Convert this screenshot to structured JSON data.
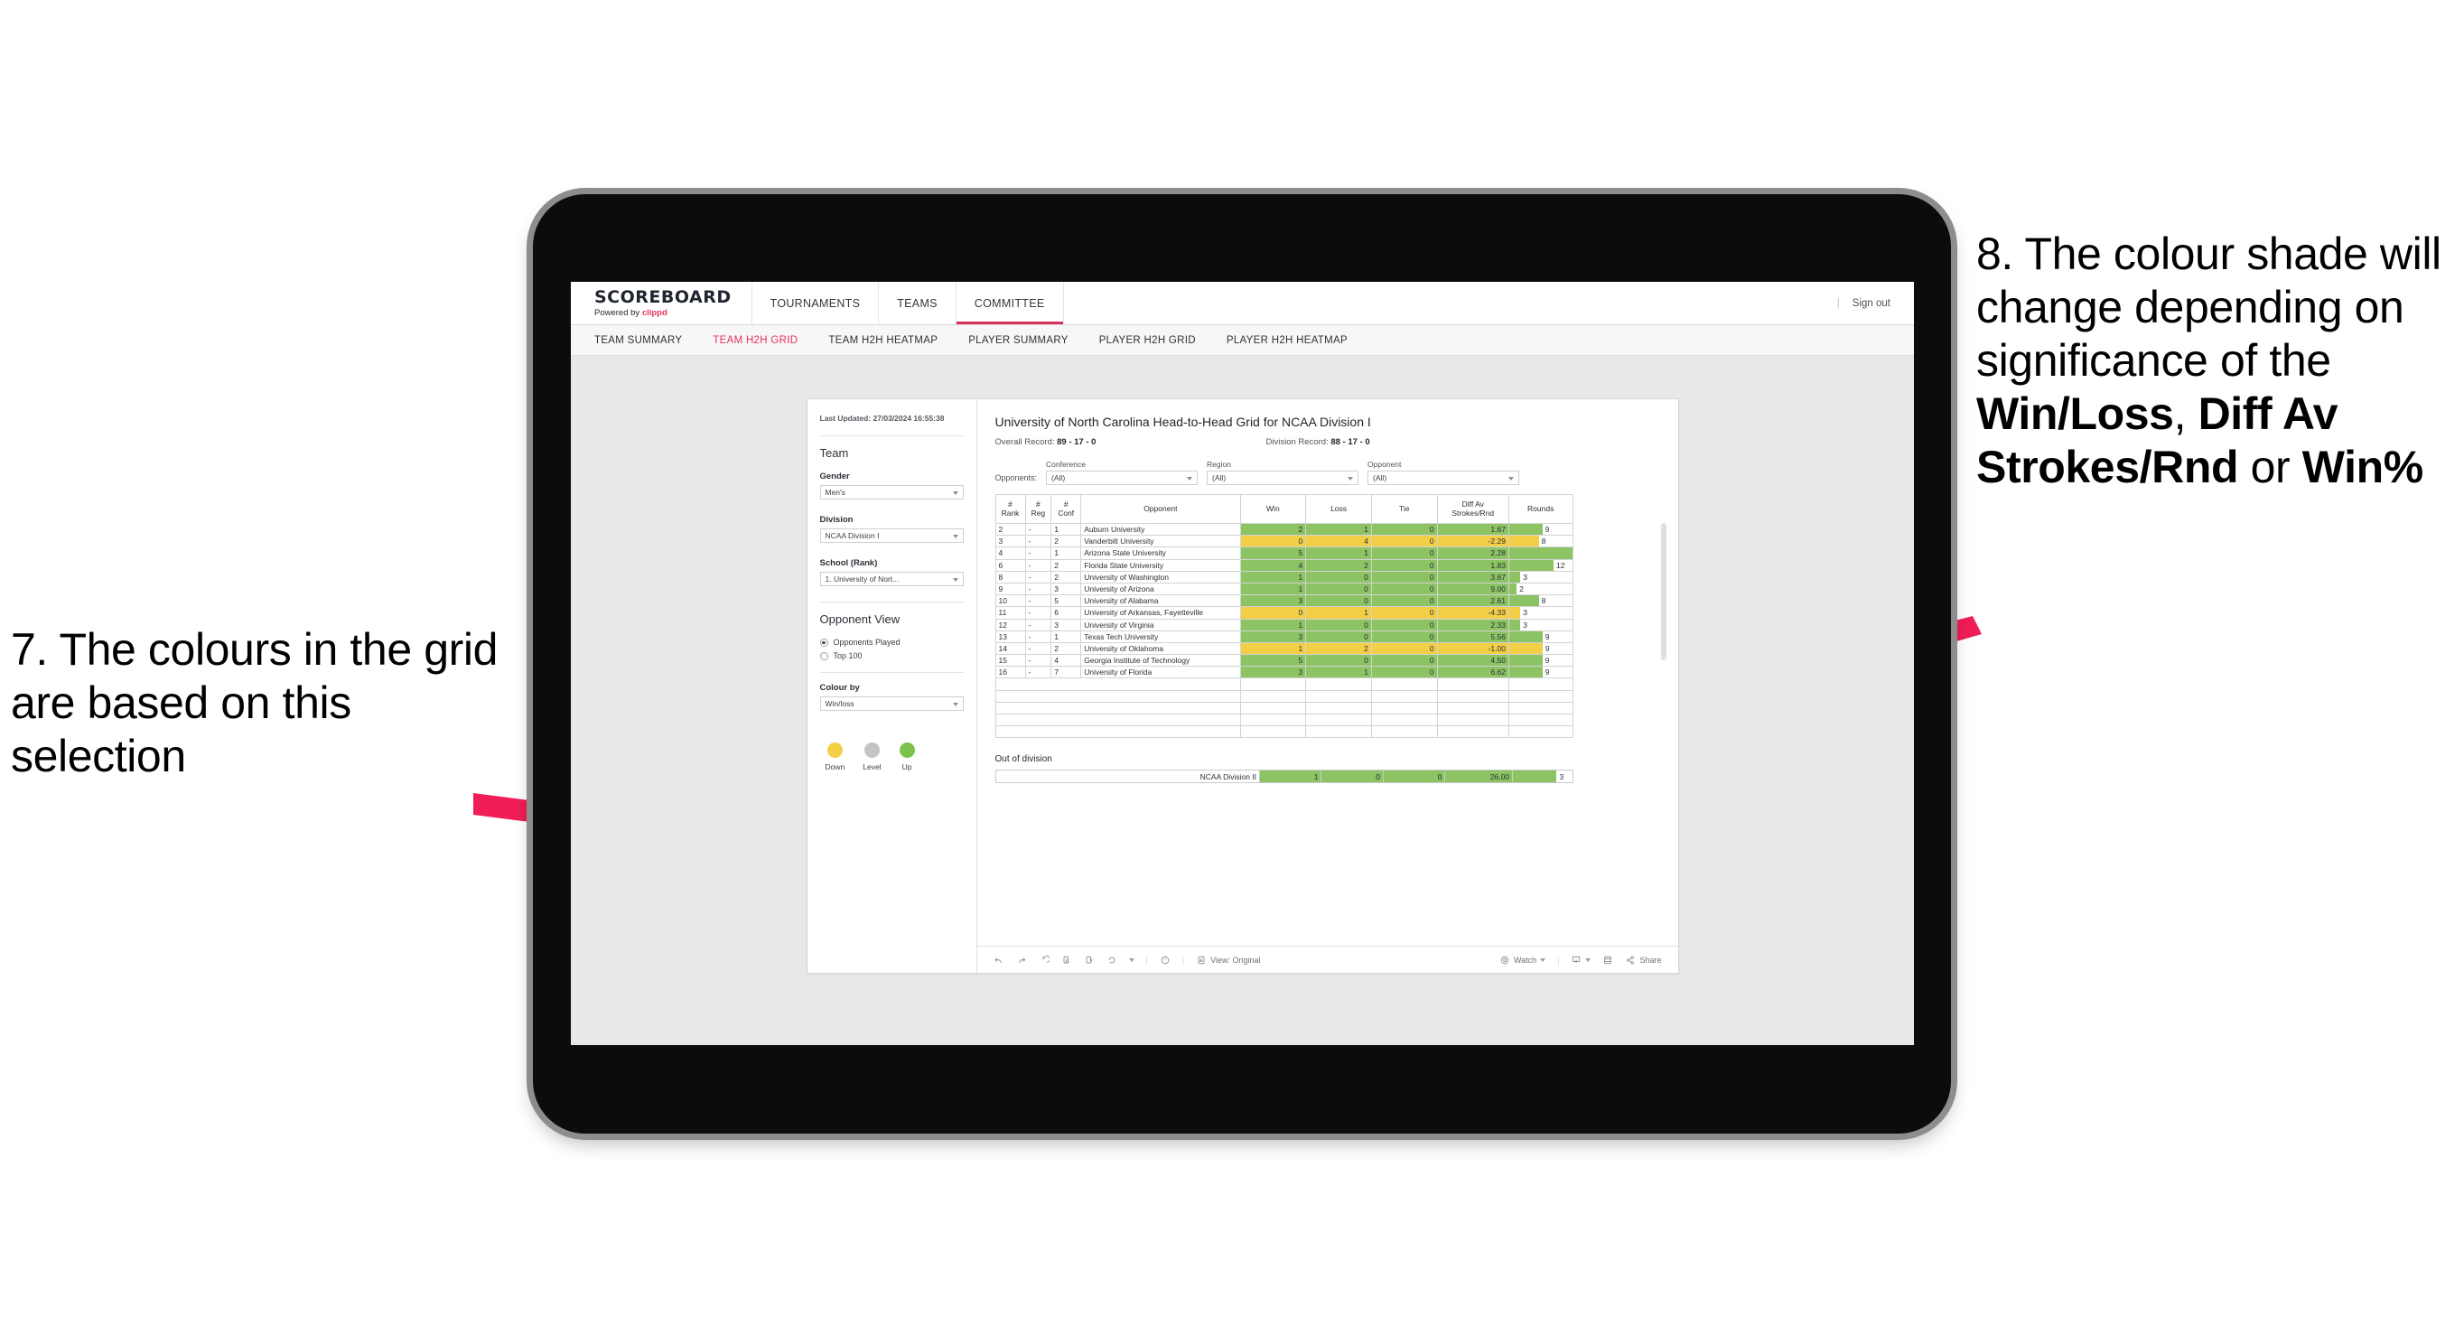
{
  "annotations": {
    "left": {
      "number": "7.",
      "text": "7. The colours in the grid are based on this selection"
    },
    "right": {
      "part1": "8. The colour shade will change depending on significance of the ",
      "bold1": "Win/Loss",
      "mid1": ", ",
      "bold2": "Diff Av Strokes/Rnd",
      "mid2": " or ",
      "bold3": "Win%"
    },
    "arrow_color": "#F01D57"
  },
  "appbar": {
    "brand_title": "SCOREBOARD",
    "brand_sub_prefix": "Powered by ",
    "brand_sub_name": "clippd",
    "tabs": [
      {
        "label": "TOURNAMENTS",
        "active": false
      },
      {
        "label": "TEAMS",
        "active": false
      },
      {
        "label": "COMMITTEE",
        "active": true
      }
    ],
    "divider": "|",
    "sign_out": "Sign out"
  },
  "subnav": {
    "items": [
      {
        "label": "TEAM SUMMARY",
        "active": false
      },
      {
        "label": "TEAM H2H GRID",
        "active": true
      },
      {
        "label": "TEAM H2H HEATMAP",
        "active": false
      },
      {
        "label": "PLAYER SUMMARY",
        "active": false
      },
      {
        "label": "PLAYER H2H GRID",
        "active": false
      },
      {
        "label": "PLAYER H2H HEATMAP",
        "active": false
      }
    ]
  },
  "panel": {
    "last_updated": "Last Updated: 27/03/2024 16:55:38",
    "team_heading": "Team",
    "gender_label": "Gender",
    "gender_value": "Men's",
    "division_label": "Division",
    "division_value": "NCAA Division I",
    "school_label": "School (Rank)",
    "school_value": "1. University of Nort...",
    "opponent_view_heading": "Opponent View",
    "radio_opponents_played": "Opponents Played",
    "radio_top_100": "Top 100",
    "colour_by_label": "Colour by",
    "colour_by_value": "Win/loss",
    "legend": [
      {
        "label": "Down",
        "color": "#F2CF46"
      },
      {
        "label": "Level",
        "color": "#C2C4C6"
      },
      {
        "label": "Up",
        "color": "#7DC24B"
      }
    ]
  },
  "content": {
    "title": "University of North Carolina Head-to-Head Grid for NCAA Division I",
    "overall_record_label": "Overall Record: ",
    "overall_record_value": "89 - 17 - 0",
    "division_record_label": "Division Record: ",
    "division_record_value": "88 - 17 - 0",
    "opponents_lead": "Opponents:",
    "filters": [
      {
        "label": "Conference",
        "value": "(All)"
      },
      {
        "label": "Region",
        "value": "(All)"
      },
      {
        "label": "Opponent",
        "value": "(All)"
      }
    ],
    "out_of_division_title": "Out of division",
    "out_of_division_row": {
      "label": "NCAA Division II",
      "win": "1",
      "loss": "0",
      "tie": "0",
      "diff": "26.00",
      "rounds": "3"
    }
  },
  "chart_data": {
    "type": "table",
    "title": "University of North Carolina Head-to-Head Grid for NCAA Division I",
    "columns": [
      "# Rank",
      "# Reg",
      "# Conf",
      "Opponent",
      "Win",
      "Loss",
      "Tie",
      "Diff Av Strokes/Rnd",
      "Rounds"
    ],
    "column_header_lines": [
      [
        "#",
        "Rank"
      ],
      [
        "#",
        "Reg"
      ],
      [
        "#",
        "Conf"
      ],
      [
        "Opponent"
      ],
      [
        "Win"
      ],
      [
        "Loss"
      ],
      [
        "Tie"
      ],
      [
        "Diff Av",
        "Strokes/Rnd"
      ],
      [
        "Rounds"
      ]
    ],
    "colour_by": "Win/loss",
    "colours": {
      "up": "#8CC363",
      "down": "#F2CF46",
      "level": "#C2C4C6",
      "bar": "#8CC363"
    },
    "rounds_max": 17,
    "rows": [
      {
        "rank": "2",
        "reg": "-",
        "conf": "1",
        "opponent": "Auburn University",
        "win": 2,
        "loss": 1,
        "tie": 0,
        "diff": "1.67",
        "rounds": 9,
        "state": "up"
      },
      {
        "rank": "3",
        "reg": "-",
        "conf": "2",
        "opponent": "Vanderbilt University",
        "win": 0,
        "loss": 4,
        "tie": 0,
        "diff": "-2.29",
        "rounds": 8,
        "state": "down"
      },
      {
        "rank": "4",
        "reg": "-",
        "conf": "1",
        "opponent": "Arizona State University",
        "win": 5,
        "loss": 1,
        "tie": 0,
        "diff": "2.28",
        "rounds": 17,
        "state": "up"
      },
      {
        "rank": "6",
        "reg": "-",
        "conf": "2",
        "opponent": "Florida State University",
        "win": 4,
        "loss": 2,
        "tie": 0,
        "diff": "1.83",
        "rounds": 12,
        "state": "up"
      },
      {
        "rank": "8",
        "reg": "-",
        "conf": "2",
        "opponent": "University of Washington",
        "win": 1,
        "loss": 0,
        "tie": 0,
        "diff": "3.67",
        "rounds": 3,
        "state": "up"
      },
      {
        "rank": "9",
        "reg": "-",
        "conf": "3",
        "opponent": "University of Arizona",
        "win": 1,
        "loss": 0,
        "tie": 0,
        "diff": "9.00",
        "rounds": 2,
        "state": "up"
      },
      {
        "rank": "10",
        "reg": "-",
        "conf": "5",
        "opponent": "University of Alabama",
        "win": 3,
        "loss": 0,
        "tie": 0,
        "diff": "2.61",
        "rounds": 8,
        "state": "up"
      },
      {
        "rank": "11",
        "reg": "-",
        "conf": "6",
        "opponent": "University of Arkansas, Fayetteville",
        "win": 0,
        "loss": 1,
        "tie": 0,
        "diff": "-4.33",
        "rounds": 3,
        "state": "down"
      },
      {
        "rank": "12",
        "reg": "-",
        "conf": "3",
        "opponent": "University of Virginia",
        "win": 1,
        "loss": 0,
        "tie": 0,
        "diff": "2.33",
        "rounds": 3,
        "state": "up"
      },
      {
        "rank": "13",
        "reg": "-",
        "conf": "1",
        "opponent": "Texas Tech University",
        "win": 3,
        "loss": 0,
        "tie": 0,
        "diff": "5.56",
        "rounds": 9,
        "state": "up"
      },
      {
        "rank": "14",
        "reg": "-",
        "conf": "2",
        "opponent": "University of Oklahoma",
        "win": 1,
        "loss": 2,
        "tie": 0,
        "diff": "-1.00",
        "rounds": 9,
        "state": "down"
      },
      {
        "rank": "15",
        "reg": "-",
        "conf": "4",
        "opponent": "Georgia Institute of Technology",
        "win": 5,
        "loss": 0,
        "tie": 0,
        "diff": "4.50",
        "rounds": 9,
        "state": "up"
      },
      {
        "rank": "16",
        "reg": "-",
        "conf": "7",
        "opponent": "University of Florida",
        "win": 3,
        "loss": 1,
        "tie": 0,
        "diff": "6.62",
        "rounds": 9,
        "state": "up"
      }
    ]
  },
  "toolbar": {
    "view_label": "View: Original",
    "watch_label": "Watch",
    "share_label": "Share",
    "sep": "|"
  }
}
